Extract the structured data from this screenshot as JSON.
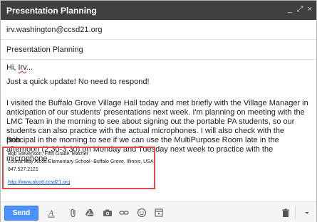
{
  "window": {
    "title": "Presentation Planning",
    "controls": {
      "minimize": "_",
      "maximize": "⤢",
      "close": "×"
    }
  },
  "compose": {
    "to": "irv.washington@ccsd21.org",
    "subject": "Presentation Planning",
    "greeting_prefix": "Hi, ",
    "greeting_name": "Irv",
    "greeting_suffix": "...",
    "quick_line": "Just a quick update! No need to respond!",
    "paragraph": "I visited the Buffalo Grove Village Hall today and met briefly with the Village Manager in anticipation of our students' presentations next week. I'm planning on meeting with the LMC Team in the morning to see about signing out the portable PA students, so our students can also practice with the actual microphones. I will also check with the principal in the morning to see if we can use the MultiPurpose Room late in the afternoon (2.30-3.30) on Monday and Tuesday next week to practice with the microphone.",
    "signoff": "Bob"
  },
  "signature": {
    "line1": "Bob Stevenson, Fifth Grade Teacher",
    "line2": "Louisa May Alcott Elementary School--Buffalo Grove, Illinois, USA",
    "line3": "847.527.2121",
    "link": "http://www.alcott.ccsd21.org",
    "highlight_color": "#e04a4a"
  },
  "toolbar": {
    "send_label": "Send",
    "icons": [
      "format-text-icon",
      "attach-icon",
      "drive-icon",
      "photo-icon",
      "link-icon",
      "emoji-icon",
      "calendar-icon",
      "trash-icon",
      "more-options-icon"
    ],
    "accent": "#4d90fe"
  }
}
